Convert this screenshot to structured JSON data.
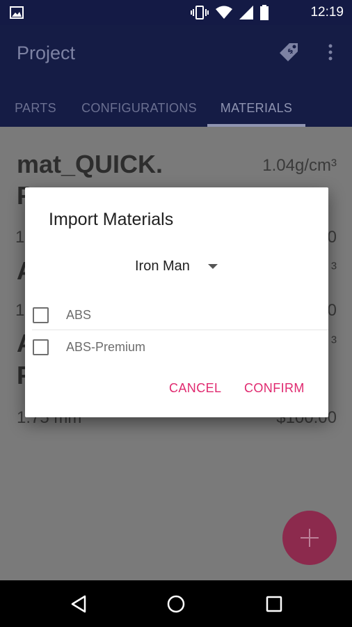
{
  "status_bar": {
    "time": "12:19",
    "icons": [
      "image-icon",
      "vibrate-icon",
      "wifi-icon",
      "signal-icon",
      "battery-icon"
    ]
  },
  "app_bar": {
    "title": "Project",
    "actions": [
      "tag-price-icon",
      "more-vert-icon"
    ],
    "tabs": [
      {
        "label": "PARTS",
        "active": false
      },
      {
        "label": "CONFIGURATIONS",
        "active": false
      },
      {
        "label": "MATERIALS",
        "active": true
      }
    ]
  },
  "background": {
    "material_title_line1": "mat_QUICK.",
    "material_title_line2": "P",
    "density": "1.04g/cm³",
    "partial_rows": [
      {
        "left": "1",
        "right": "0"
      },
      {
        "left": "A",
        "right": "³"
      },
      {
        "left": "1",
        "right": "0"
      },
      {
        "left": "A",
        "right": "³"
      },
      {
        "left": "P",
        "right": ""
      }
    ],
    "diameter": "1.75 mm",
    "price": "$100.00"
  },
  "dialog": {
    "title": "Import Materials",
    "selected_source": "Iron Man",
    "options": [
      {
        "label": "ABS",
        "checked": false
      },
      {
        "label": "ABS-Premium",
        "checked": false
      }
    ],
    "cancel_label": "CANCEL",
    "confirm_label": "CONFIRM"
  },
  "colors": {
    "primary": "#151c45",
    "accent": "#e0296f",
    "scrim_bg": "#7a7a7a"
  }
}
